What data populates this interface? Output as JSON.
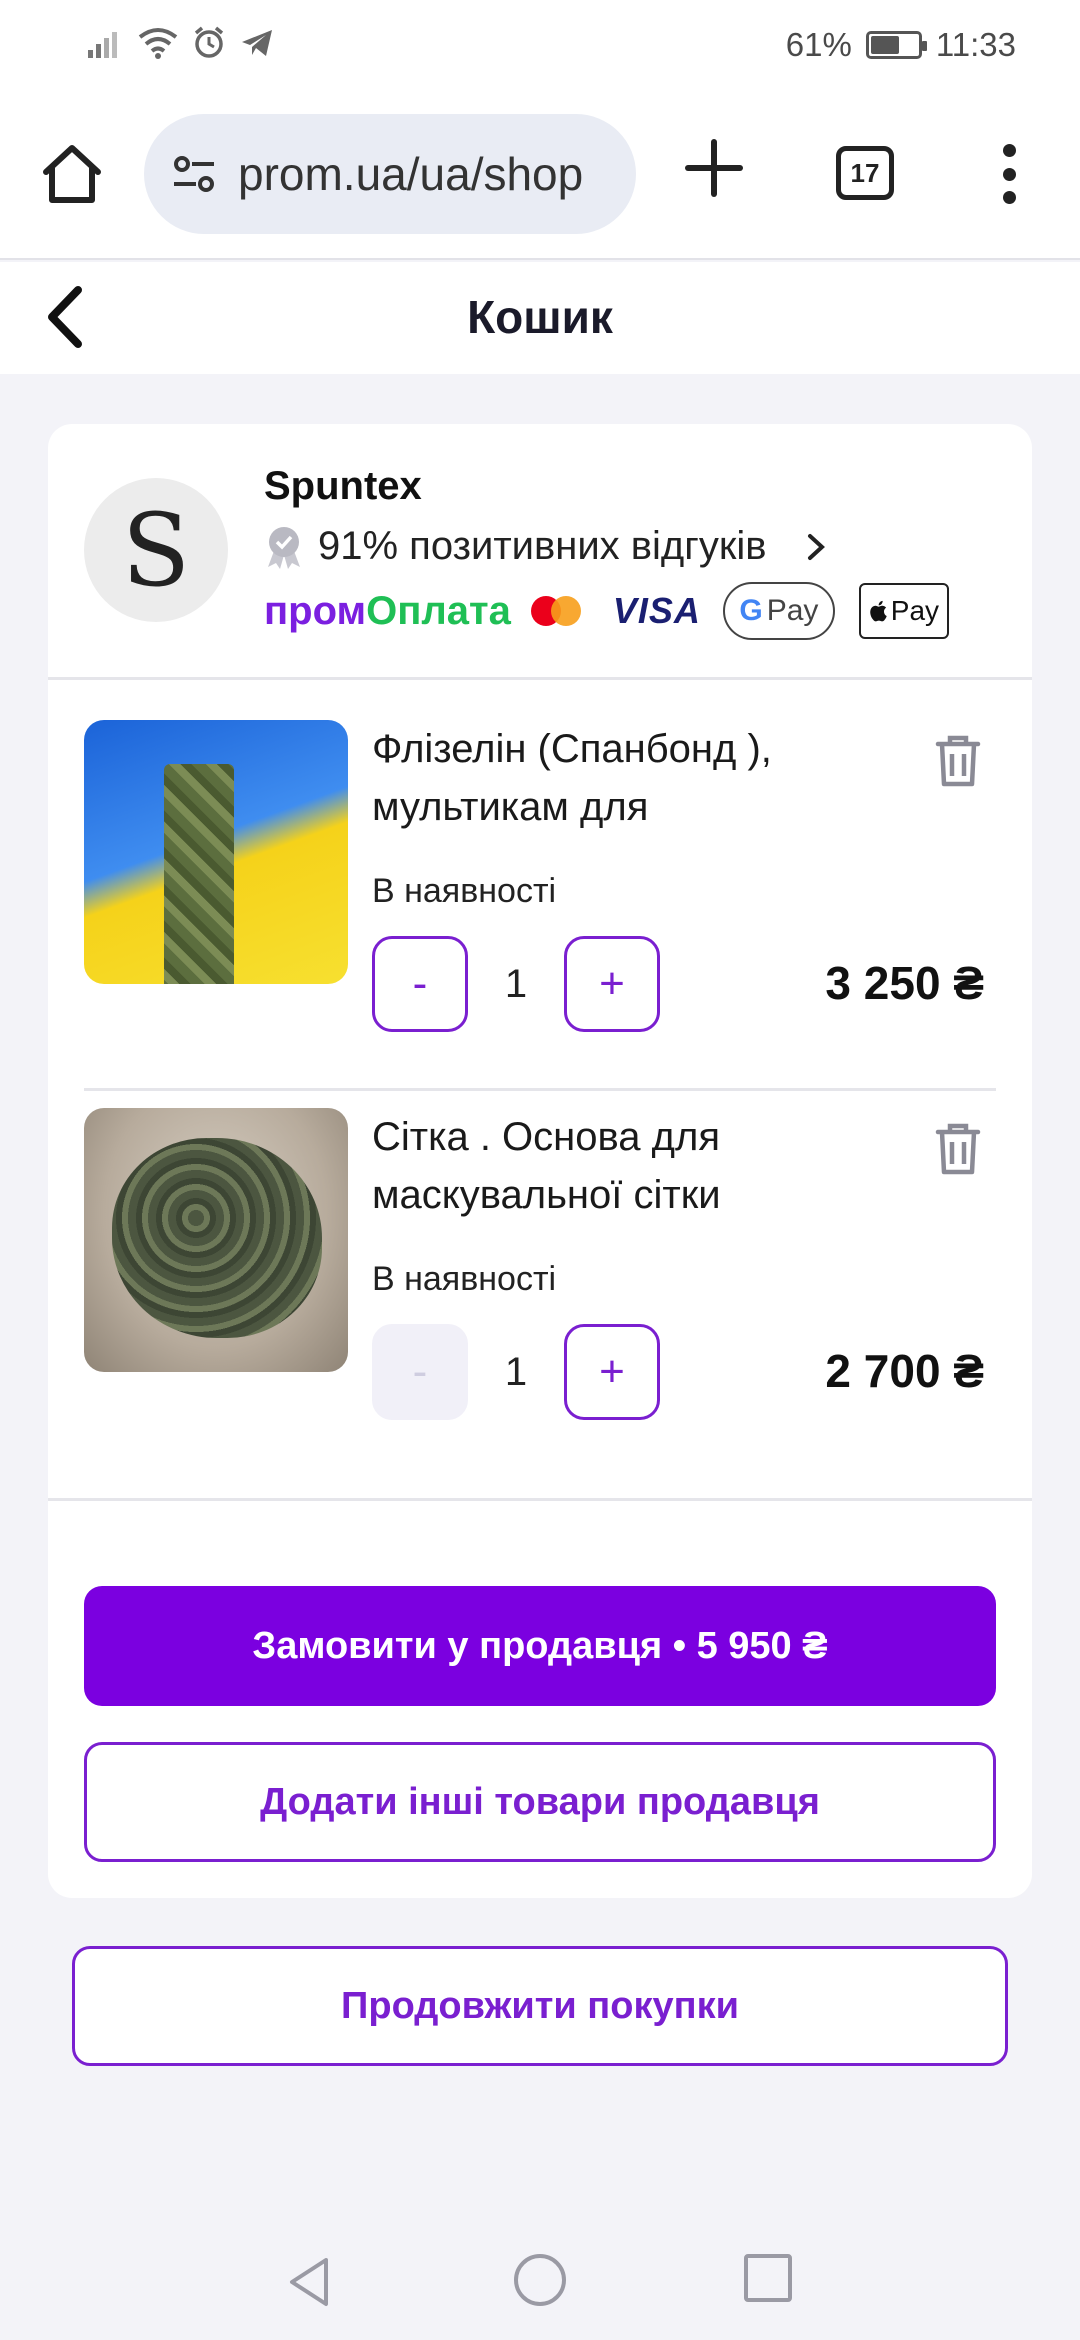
{
  "status_bar": {
    "battery_percent": "61%",
    "battery_level": 0.61,
    "time": "11:33",
    "icons": [
      "signal-icon",
      "wifi-icon",
      "alarm-icon",
      "telegram-icon"
    ]
  },
  "browser": {
    "url": "prom.ua/ua/shop",
    "tab_count": "17",
    "icons": [
      "home-icon",
      "site-settings-icon",
      "new-tab-icon",
      "menu-dots-icon"
    ]
  },
  "page": {
    "title": "Кошик"
  },
  "seller": {
    "avatar_letter": "S",
    "name": "Spuntex",
    "rating_text": "91% позитивних відгуків",
    "pay_prom_part1": "пром",
    "pay_prom_part2": "Оплата",
    "visa_label": "VISA",
    "gpay_label": "Pay",
    "gpay_g": "G",
    "apple_pay_label": "Pay"
  },
  "items": [
    {
      "title": "Флізелін (Спанбонд ), мультикам для",
      "availability": "В наявності",
      "quantity": "1",
      "minus_label": "-",
      "plus_label": "+",
      "price": "3 250 ₴"
    },
    {
      "title": "Сітка . Основа для маскувальної сітки",
      "availability": "В наявності",
      "quantity": "1",
      "minus_label": "-",
      "plus_label": "+",
      "price": "2 700 ₴"
    }
  ],
  "actions": {
    "order_label": "Замовити у продавця • 5 950 ₴",
    "add_more_label": "Додати інші товари продавця",
    "continue_label": "Продовжити покупки"
  },
  "colors": {
    "accent": "#7b00e0",
    "accent_outline": "#7a1fd0",
    "background": "#f3f3f8",
    "prom_green": "#1fbf55"
  }
}
